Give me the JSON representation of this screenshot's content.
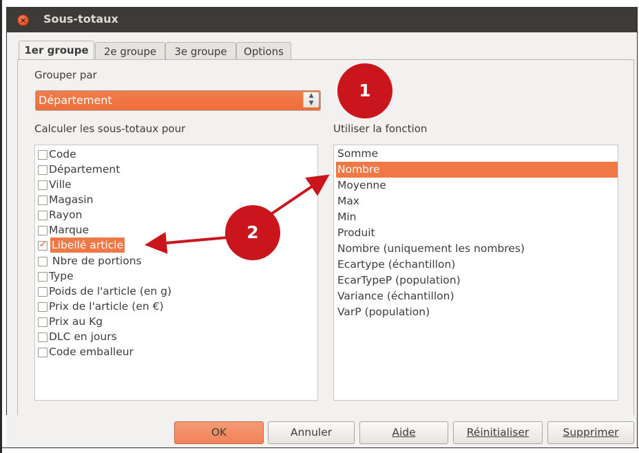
{
  "window": {
    "title": "Sous-totaux",
    "close_icon": "close-icon"
  },
  "tabs": [
    {
      "label": "1er groupe",
      "active": true
    },
    {
      "label": "2e groupe",
      "active": false
    },
    {
      "label": "3e groupe",
      "active": false
    },
    {
      "label": "Options",
      "active": false
    }
  ],
  "group_by": {
    "label": "Grouper par",
    "value": "Département"
  },
  "calc_subtotals": {
    "label": "Calculer les sous-totaux pour",
    "items": [
      {
        "label": "Code",
        "checked": false,
        "selected": false
      },
      {
        "label": "Département",
        "checked": false,
        "selected": false
      },
      {
        "label": "Ville",
        "checked": false,
        "selected": false
      },
      {
        "label": "Magasin",
        "checked": false,
        "selected": false
      },
      {
        "label": "Rayon",
        "checked": false,
        "selected": false
      },
      {
        "label": "Marque",
        "checked": false,
        "selected": false
      },
      {
        "label": "Libellé article",
        "checked": true,
        "selected": true
      },
      {
        "label": " Nbre de portions",
        "checked": false,
        "selected": false
      },
      {
        "label": "Type",
        "checked": false,
        "selected": false
      },
      {
        "label": "Poids de l'article (en g)",
        "checked": false,
        "selected": false
      },
      {
        "label": "Prix de l'article (en €)",
        "checked": false,
        "selected": false
      },
      {
        "label": "Prix au Kg",
        "checked": false,
        "selected": false
      },
      {
        "label": "DLC en jours",
        "checked": false,
        "selected": false
      },
      {
        "label": "Code emballeur",
        "checked": false,
        "selected": false
      }
    ]
  },
  "use_function": {
    "label": "Utiliser la fonction",
    "items": [
      {
        "label": "Somme",
        "selected": false
      },
      {
        "label": "Nombre",
        "selected": true
      },
      {
        "label": "Moyenne",
        "selected": false
      },
      {
        "label": "Max",
        "selected": false
      },
      {
        "label": "Min",
        "selected": false
      },
      {
        "label": "Produit",
        "selected": false
      },
      {
        "label": "Nombre (uniquement les nombres)",
        "selected": false
      },
      {
        "label": "Ecartype (échantillon)",
        "selected": false
      },
      {
        "label": "EcarTypeP (population)",
        "selected": false
      },
      {
        "label": "Variance (échantillon)",
        "selected": false
      },
      {
        "label": "VarP (population)",
        "selected": false
      }
    ]
  },
  "buttons": {
    "ok": "OK",
    "cancel": "Annuler",
    "help": "Aide",
    "reset": "Réinitialiser",
    "delete": "Supprimer"
  },
  "annotations": {
    "badge1": "1",
    "badge2": "2",
    "color": "#c9151b"
  },
  "colors": {
    "accent": "#f07746",
    "titlebar": "#3c3b37",
    "dialog_bg": "#f2f1f0"
  }
}
